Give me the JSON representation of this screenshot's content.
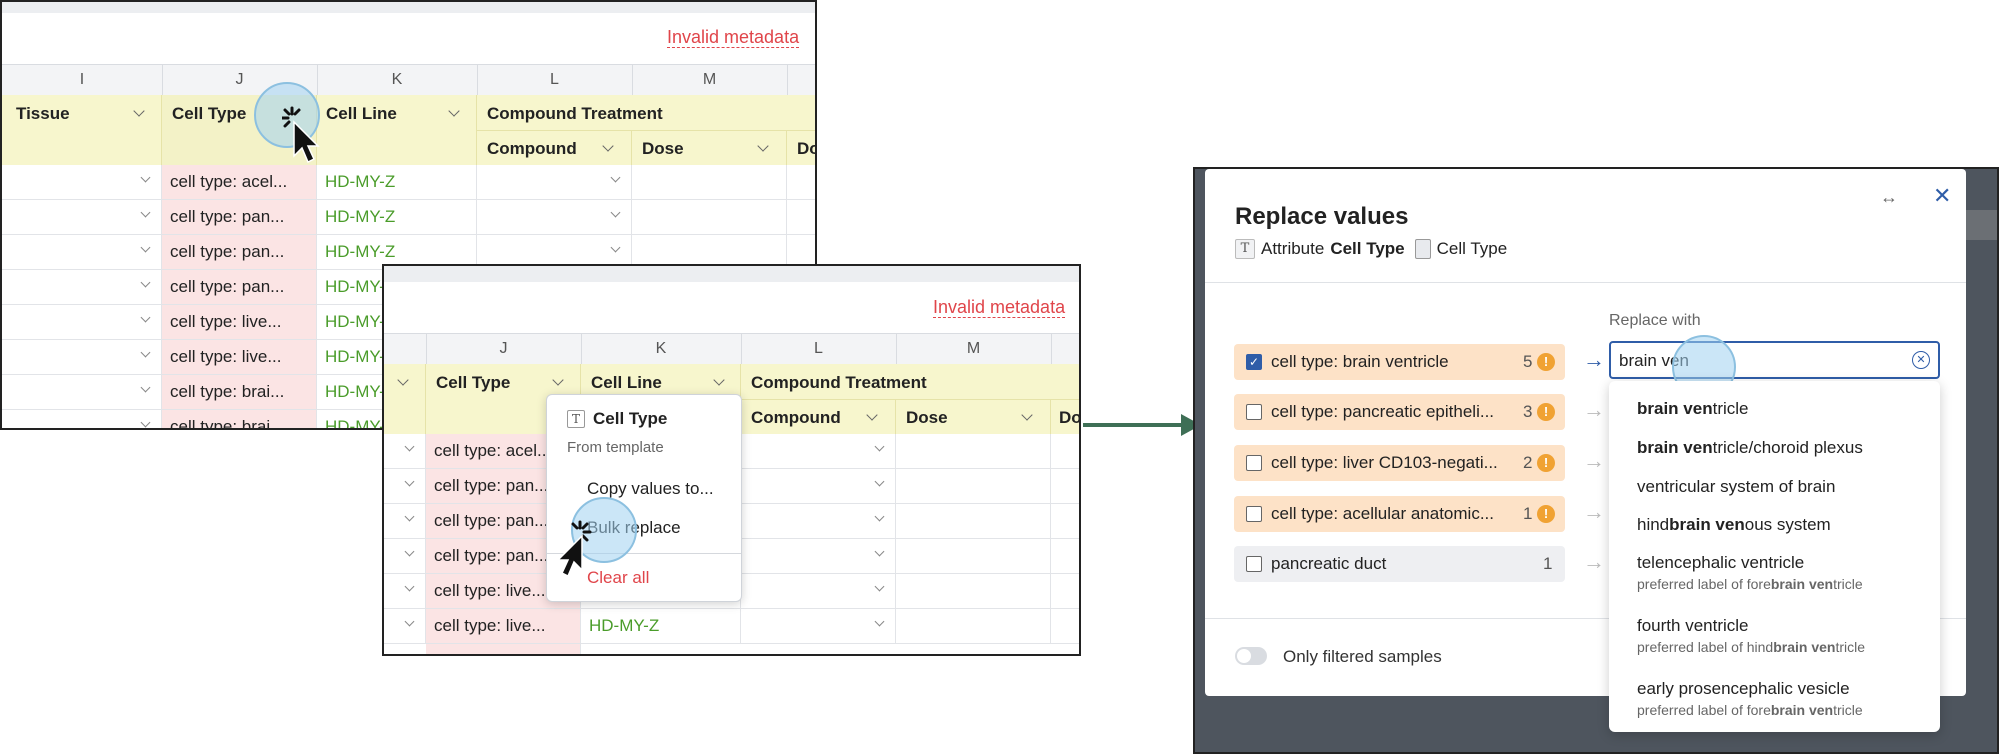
{
  "panel1": {
    "warning": "Invalid metadata",
    "columns": [
      "I",
      "J",
      "K",
      "L",
      "M"
    ],
    "headers": {
      "tissue": "Tissue",
      "cell_type": "Cell Type",
      "cell_line": "Cell Line",
      "compound_treatment": "Compound Treatment",
      "compound": "Compound",
      "dose": "Dose",
      "truncated": "Do"
    },
    "rows": [
      {
        "cell_type": "cell type: acel...",
        "cell_line": "HD-MY-Z"
      },
      {
        "cell_type": "cell type: pan...",
        "cell_line": "HD-MY-Z"
      },
      {
        "cell_type": "cell type: pan...",
        "cell_line": "HD-MY-Z"
      },
      {
        "cell_type": "cell type: pan...",
        "cell_line": "HD-MY-"
      },
      {
        "cell_type": "cell type: live...",
        "cell_line": "HD-MY-"
      },
      {
        "cell_type": "cell type: live...",
        "cell_line": "HD-MY-"
      },
      {
        "cell_type": "cell type: brai...",
        "cell_line": "HD-MY-"
      },
      {
        "cell_type": "cell type: brai...",
        "cell_line": "HD-MY-"
      }
    ]
  },
  "panel2": {
    "warning": "Invalid metadata",
    "columns": [
      "J",
      "K",
      "L",
      "M"
    ],
    "headers": {
      "cell_type": "Cell Type",
      "cell_line": "Cell Line",
      "compound_treatment": "Compound Treatment",
      "compound": "Compound",
      "dose": "Dose",
      "truncated": "Do"
    },
    "rows": [
      {
        "cell_type": "cell type: acel...",
        "cell_line": ""
      },
      {
        "cell_type": "cell type: pan...",
        "cell_line": ""
      },
      {
        "cell_type": "cell type: pan...",
        "cell_line": ""
      },
      {
        "cell_type": "cell type: pan...",
        "cell_line": ""
      },
      {
        "cell_type": "cell type: live...",
        "cell_line": ""
      },
      {
        "cell_type": "cell type: live...",
        "cell_line": "HD-MY-Z"
      }
    ],
    "menu": {
      "icon": "text-type-icon",
      "title": "Cell Type",
      "subtitle": "From template",
      "items": [
        "Copy values to...",
        "Bulk replace",
        "Clear all"
      ]
    }
  },
  "modal": {
    "title": "Replace values",
    "attribute_label": "Attribute",
    "attribute_name": "Cell Type",
    "template_name": "Cell Type",
    "replace_with_label": "Replace with",
    "input_value": "brain ven",
    "toggle_label": "Only filtered samples",
    "values": [
      {
        "label": "cell type: brain ventricle",
        "count": "5",
        "checked": true,
        "warning": true
      },
      {
        "label": "cell type: pancreatic epitheli...",
        "count": "3",
        "checked": false,
        "warning": true
      },
      {
        "label": "cell type: liver CD103-negati...",
        "count": "2",
        "checked": false,
        "warning": true
      },
      {
        "label": "cell type: acellular anatomic...",
        "count": "1",
        "checked": false,
        "warning": true
      },
      {
        "label": "pancreatic duct",
        "count": "1",
        "checked": false,
        "warning": false
      }
    ],
    "suggestions": [
      {
        "pre": "",
        "bold": "brain ven",
        "post": "tricle",
        "sub_pre": "",
        "sub_bold": "",
        "sub_post": ""
      },
      {
        "pre": "",
        "bold": "brain ven",
        "post": "tricle/choroid plexus",
        "sub_pre": "",
        "sub_bold": "",
        "sub_post": ""
      },
      {
        "pre": "ventricular system of brain",
        "bold": "",
        "post": "",
        "sub_pre": "",
        "sub_bold": "",
        "sub_post": ""
      },
      {
        "pre": "hind",
        "bold": "brain ven",
        "post": "ous system",
        "sub_pre": "",
        "sub_bold": "",
        "sub_post": ""
      },
      {
        "pre": "telencephalic ventricle",
        "bold": "",
        "post": "",
        "sub_pre": "preferred label of fore",
        "sub_bold": "brain ven",
        "sub_post": "tricle"
      },
      {
        "pre": "fourth ventricle",
        "bold": "",
        "post": "",
        "sub_pre": "preferred label of hind",
        "sub_bold": "brain ven",
        "sub_post": "tricle"
      },
      {
        "pre": "early prosencephalic vesicle",
        "bold": "",
        "post": "",
        "sub_pre": "preferred label of fore",
        "sub_bold": "brain ven",
        "sub_post": "tricle"
      }
    ],
    "colors": {
      "row_warning_bg": "#fde2c7",
      "row_plain_bg": "#eeeff2",
      "warning_icon": "#f0a233",
      "accent": "#2f5da8"
    }
  }
}
